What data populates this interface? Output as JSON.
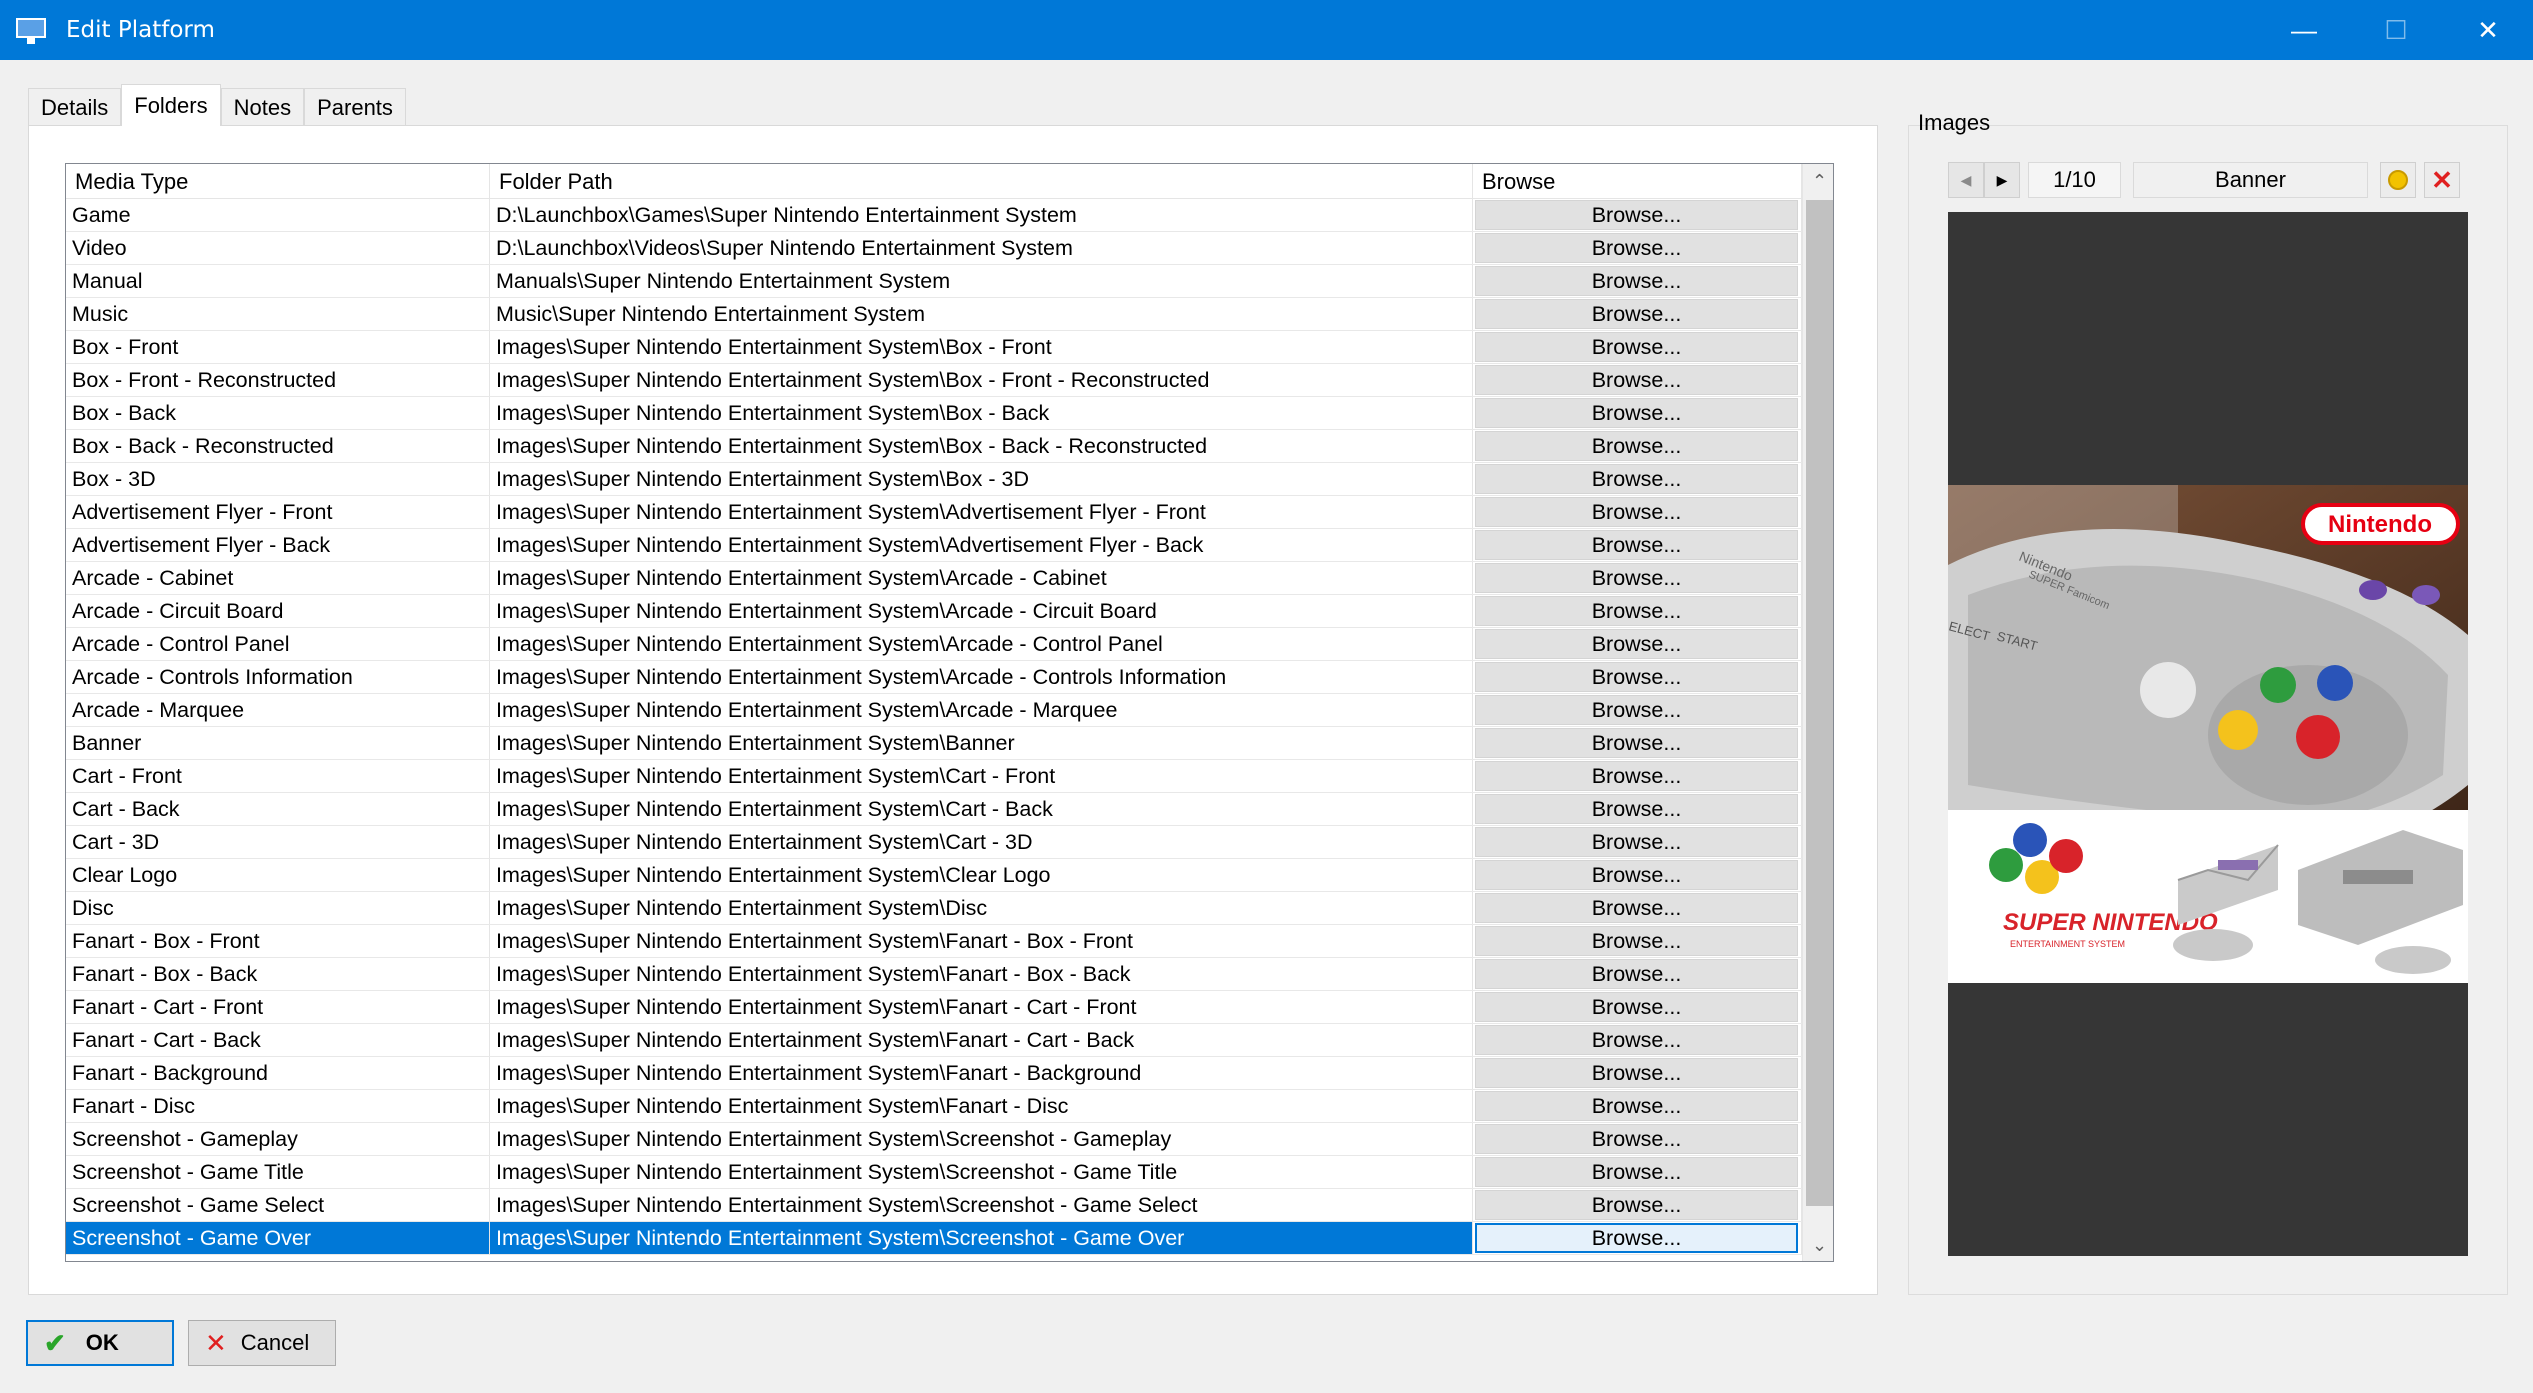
{
  "window": {
    "title": "Edit Platform",
    "minimize_glyph": "—",
    "maximize_glyph": "☐",
    "close_glyph": "✕"
  },
  "tabs": [
    {
      "label": "Details"
    },
    {
      "label": "Folders",
      "active": true
    },
    {
      "label": "Notes"
    },
    {
      "label": "Parents"
    }
  ],
  "grid": {
    "headers": {
      "media": "Media Type",
      "path": "Folder Path",
      "browse": "Browse"
    },
    "browse_label": "Browse...",
    "rows": [
      {
        "media": "Game",
        "path": "D:\\Launchbox\\Games\\Super Nintendo Entertainment System"
      },
      {
        "media": "Video",
        "path": "D:\\Launchbox\\Videos\\Super Nintendo Entertainment System"
      },
      {
        "media": "Manual",
        "path": "Manuals\\Super Nintendo Entertainment System"
      },
      {
        "media": "Music",
        "path": "Music\\Super Nintendo Entertainment System"
      },
      {
        "media": "Box - Front",
        "path": "Images\\Super Nintendo Entertainment System\\Box - Front"
      },
      {
        "media": "Box - Front - Reconstructed",
        "path": "Images\\Super Nintendo Entertainment System\\Box - Front - Reconstructed"
      },
      {
        "media": "Box - Back",
        "path": "Images\\Super Nintendo Entertainment System\\Box - Back"
      },
      {
        "media": "Box - Back - Reconstructed",
        "path": "Images\\Super Nintendo Entertainment System\\Box - Back - Reconstructed"
      },
      {
        "media": "Box - 3D",
        "path": "Images\\Super Nintendo Entertainment System\\Box - 3D"
      },
      {
        "media": "Advertisement Flyer - Front",
        "path": "Images\\Super Nintendo Entertainment System\\Advertisement Flyer - Front"
      },
      {
        "media": "Advertisement Flyer - Back",
        "path": "Images\\Super Nintendo Entertainment System\\Advertisement Flyer - Back"
      },
      {
        "media": "Arcade - Cabinet",
        "path": "Images\\Super Nintendo Entertainment System\\Arcade - Cabinet"
      },
      {
        "media": "Arcade - Circuit Board",
        "path": "Images\\Super Nintendo Entertainment System\\Arcade - Circuit Board"
      },
      {
        "media": "Arcade - Control Panel",
        "path": "Images\\Super Nintendo Entertainment System\\Arcade - Control Panel"
      },
      {
        "media": "Arcade - Controls Information",
        "path": "Images\\Super Nintendo Entertainment System\\Arcade - Controls Information"
      },
      {
        "media": "Arcade - Marquee",
        "path": "Images\\Super Nintendo Entertainment System\\Arcade - Marquee"
      },
      {
        "media": "Banner",
        "path": "Images\\Super Nintendo Entertainment System\\Banner"
      },
      {
        "media": "Cart - Front",
        "path": "Images\\Super Nintendo Entertainment System\\Cart - Front"
      },
      {
        "media": "Cart - Back",
        "path": "Images\\Super Nintendo Entertainment System\\Cart - Back"
      },
      {
        "media": "Cart - 3D",
        "path": "Images\\Super Nintendo Entertainment System\\Cart - 3D"
      },
      {
        "media": "Clear Logo",
        "path": "Images\\Super Nintendo Entertainment System\\Clear Logo"
      },
      {
        "media": "Disc",
        "path": "Images\\Super Nintendo Entertainment System\\Disc"
      },
      {
        "media": "Fanart - Box - Front",
        "path": "Images\\Super Nintendo Entertainment System\\Fanart - Box - Front"
      },
      {
        "media": "Fanart - Box - Back",
        "path": "Images\\Super Nintendo Entertainment System\\Fanart - Box - Back"
      },
      {
        "media": "Fanart - Cart - Front",
        "path": "Images\\Super Nintendo Entertainment System\\Fanart - Cart - Front"
      },
      {
        "media": "Fanart - Cart - Back",
        "path": "Images\\Super Nintendo Entertainment System\\Fanart - Cart - Back"
      },
      {
        "media": "Fanart - Background",
        "path": "Images\\Super Nintendo Entertainment System\\Fanart - Background"
      },
      {
        "media": "Fanart - Disc",
        "path": "Images\\Super Nintendo Entertainment System\\Fanart - Disc"
      },
      {
        "media": "Screenshot - Gameplay",
        "path": "Images\\Super Nintendo Entertainment System\\Screenshot - Gameplay"
      },
      {
        "media": "Screenshot - Game Title",
        "path": "Images\\Super Nintendo Entertainment System\\Screenshot - Game Title"
      },
      {
        "media": "Screenshot - Game Select",
        "path": "Images\\Super Nintendo Entertainment System\\Screenshot - Game Select"
      },
      {
        "media": "Screenshot - Game Over",
        "path": "Images\\Super Nintendo Entertainment System\\Screenshot - Game Over",
        "selected": true
      }
    ]
  },
  "images": {
    "label": "Images",
    "counter": "1/10",
    "type": "Banner",
    "banner_logo_text": "Nintendo",
    "banner_sub_text": "SUPER NINTENDO",
    "banner_sub_small": "ENTERTAINMENT SYSTEM",
    "controller_text_1": "Nintendo",
    "controller_text_2": "SUPER Famicom",
    "controller_select": "ELECT",
    "controller_start": "START"
  },
  "buttons": {
    "ok": "OK",
    "cancel": "Cancel"
  },
  "colors": {
    "accent": "#0078d7",
    "selected_row": "#0078d7"
  }
}
